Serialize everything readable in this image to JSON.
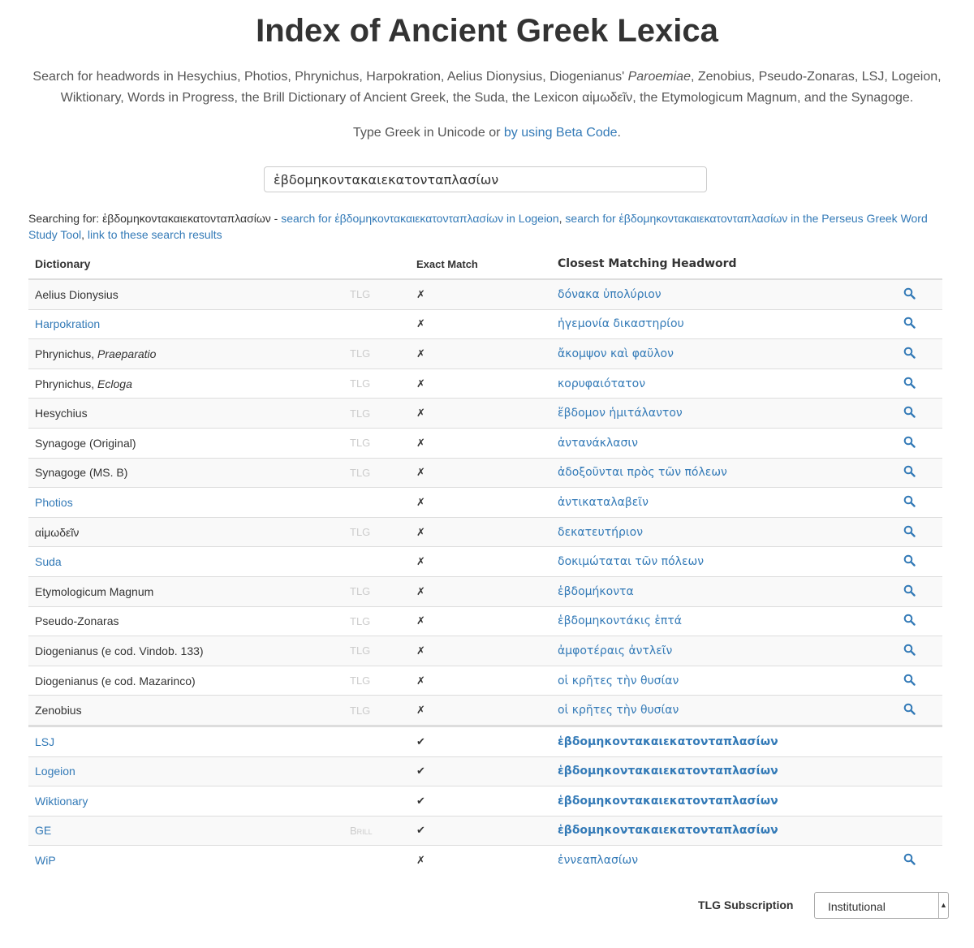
{
  "title": "Index of Ancient Greek Lexica",
  "description_pre": "Search for headwords in Hesychius, Photios, Phrynichus, Harpokration, Aelius Dionysius, Diogenianus' ",
  "description_em": "Paroemiae",
  "description_post": ", Zenobius, Pseudo-Zonaras, LSJ, Logeion, Wiktionary, Words in Progress, the Brill Dictionary of Ancient Greek, the Suda, the Lexicon αἱμωδεῖν, the Etymologicum Magnum, and the Synagoge.",
  "hint_text": "Type Greek in Unicode or ",
  "hint_link": "by using Beta Code",
  "hint_end": ".",
  "search": {
    "value": "ἑβδομηκοντακαιεκατονταπλασίων"
  },
  "searching": {
    "label": "Searching for: ",
    "term": "ἑβδομηκοντακαιεκατονταπλασίων",
    "sep": " - ",
    "logeion_link": "search for ἑβδομηκοντακαιεκατονταπλασίων in Logeion",
    "comma1": ", ",
    "perseus_link": "search for ἑβδομηκοντακαιεκατονταπλασίων in the Perseus Greek Word Study Tool",
    "comma2": ", ",
    "results_link": "link to these search results"
  },
  "table": {
    "headers": {
      "dictionary": "Dictionary",
      "exact": "Exact Match",
      "closest": "Closest Matching Headword"
    },
    "rows": [
      {
        "name": "Aelius Dionysius",
        "name_em": "",
        "link": false,
        "source": "TLG",
        "exact": "✗",
        "headword": "δόνακα ὑπολύριον",
        "bold": false,
        "mag": true
      },
      {
        "name": "Harpokration",
        "name_em": "",
        "link": true,
        "source": "",
        "exact": "✗",
        "headword": "ἡγεμονία δικαστηρίου",
        "bold": false,
        "mag": true
      },
      {
        "name": "Phrynichus, ",
        "name_em": "Praeparatio",
        "link": false,
        "source": "TLG",
        "exact": "✗",
        "headword": "ἄκομψον καὶ φαῦλον",
        "bold": false,
        "mag": true
      },
      {
        "name": "Phrynichus, ",
        "name_em": "Ecloga",
        "link": false,
        "source": "TLG",
        "exact": "✗",
        "headword": "κορυφαιότατον",
        "bold": false,
        "mag": true
      },
      {
        "name": "Hesychius",
        "name_em": "",
        "link": false,
        "source": "TLG",
        "exact": "✗",
        "headword": "ἕβδομον ἡμιτάλαντον",
        "bold": false,
        "mag": true
      },
      {
        "name": "Synagoge (Original)",
        "name_em": "",
        "link": false,
        "source": "TLG",
        "exact": "✗",
        "headword": "ἀντανάκλασιν",
        "bold": false,
        "mag": true
      },
      {
        "name": "Synagoge (MS. B)",
        "name_em": "",
        "link": false,
        "source": "TLG",
        "exact": "✗",
        "headword": "ἀδοξοῦνται πρὸς τῶν πόλεων",
        "bold": false,
        "mag": true
      },
      {
        "name": "Photios",
        "name_em": "",
        "link": true,
        "source": "",
        "exact": "✗",
        "headword": "ἀντικαταλαβεῖν",
        "bold": false,
        "mag": true
      },
      {
        "name": "αἱμωδεῖν",
        "name_em": "",
        "link": false,
        "source": "TLG",
        "exact": "✗",
        "headword": "δεκατευτήριον",
        "bold": false,
        "mag": true
      },
      {
        "name": "Suda",
        "name_em": "",
        "link": true,
        "source": "",
        "exact": "✗",
        "headword": "δοκιμώταται τῶν πόλεων",
        "bold": false,
        "mag": true
      },
      {
        "name": "Etymologicum Magnum",
        "name_em": "",
        "link": false,
        "source": "TLG",
        "exact": "✗",
        "headword": "ἑβδομήκοντα",
        "bold": false,
        "mag": true
      },
      {
        "name": "Pseudo-Zonaras",
        "name_em": "",
        "link": false,
        "source": "TLG",
        "exact": "✗",
        "headword": "ἑβδομηκοντάκις ἑπτά",
        "bold": false,
        "mag": true
      },
      {
        "name": "Diogenianus (e cod. Vindob. 133)",
        "name_em": "",
        "link": false,
        "source": "TLG",
        "exact": "✗",
        "headword": "ἀμφοτέραις ἀντλεῖν",
        "bold": false,
        "mag": true
      },
      {
        "name": "Diogenianus (e cod. Mazarinco)",
        "name_em": "",
        "link": false,
        "source": "TLG",
        "exact": "✗",
        "headword": "οἱ κρῆτες τὴν θυσίαν",
        "bold": false,
        "mag": true
      },
      {
        "name": "Zenobius",
        "name_em": "",
        "link": false,
        "source": "TLG",
        "exact": "✗",
        "headword": "οἱ κρῆτες τὴν θυσίαν",
        "bold": false,
        "mag": true
      },
      {
        "name": "LSJ",
        "name_em": "",
        "link": true,
        "source": "",
        "exact": "✔",
        "headword": "ἑβδομηκοντακαιεκατονταπλασίων",
        "bold": true,
        "mag": false
      },
      {
        "name": "Logeion",
        "name_em": "",
        "link": true,
        "source": "",
        "exact": "✔",
        "headword": "ἑβδομηκοντακαιεκατονταπλασίων",
        "bold": true,
        "mag": false
      },
      {
        "name": "Wiktionary",
        "name_em": "",
        "link": true,
        "source": "",
        "exact": "✔",
        "headword": "ἑβδομηκοντακαιεκατονταπλασίων",
        "bold": true,
        "mag": false
      },
      {
        "name": "GE",
        "name_em": "",
        "link": true,
        "source": "Brill",
        "exact": "✔",
        "headword": "ἑβδομηκοντακαιεκατονταπλασίων",
        "bold": true,
        "mag": false
      },
      {
        "name": "WiP",
        "name_em": "",
        "link": true,
        "source": "",
        "exact": "✗",
        "headword": "ἐννεαπλασίων",
        "bold": false,
        "mag": true
      }
    ]
  },
  "subscription": {
    "label": "TLG Subscription",
    "selected": "Institutional"
  },
  "colors": {
    "link": "#337ab7",
    "source_gray": "#cccccc",
    "stripe": "#f9f9f9"
  },
  "icons": {
    "row_search": "search-icon"
  }
}
